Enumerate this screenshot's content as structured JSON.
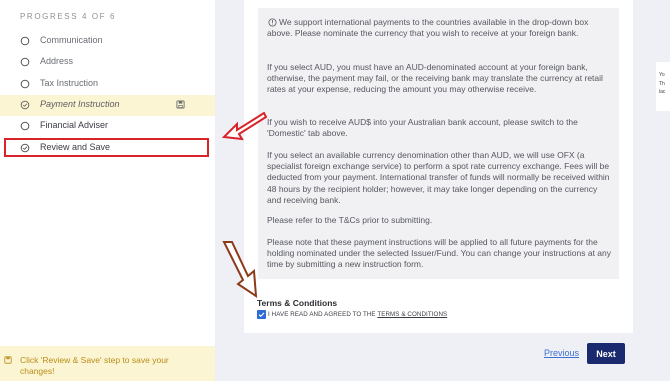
{
  "sidebar": {
    "progress": "PROGRESS 4 OF 6",
    "steps": [
      {
        "label": "Communication",
        "state": "done"
      },
      {
        "label": "Address",
        "state": "done"
      },
      {
        "label": "Tax Instruction",
        "state": "done"
      },
      {
        "label": "Payment Instruction",
        "state": "current"
      },
      {
        "label": "Financial Adviser",
        "state": "todo"
      },
      {
        "label": "Review and Save",
        "state": "highlighted"
      }
    ],
    "footer_message": "Click 'Review & Save' step to save your changes!"
  },
  "info": {
    "paragraphs": [
      "We support international payments to the countries available in the drop-down box above. Please nominate the currency that you wish to receive at your foreign bank.",
      "If you select AUD, you must have an AUD-denominated account at your foreign bank, otherwise, the payment may fail, or the receiving bank may translate the currency at retail rates at your expense, reducing the amount you may otherwise receive.",
      "If you wish to receive AUD$ into your Australian bank account, please switch to the 'Domestic' tab above.",
      "If you select an available currency denomination other than AUD, we will use OFX (a specialist foreign exchange service) to perform a spot rate currency exchange. Fees will be deducted from your payment. International transfer of funds will normally be received within 48 hours by the recipient holder; however, it may take longer depending on the currency and receiving bank.",
      "Please refer to the T&Cs prior to submitting.",
      "Please note that these payment instructions will be applied to all future payments for the holding nominated under the selected Issuer/Fund. You can change your instructions at any time by submitting a new instruction form."
    ]
  },
  "terms": {
    "title": "Terms & Conditions",
    "checkbox_prefix": "I HAVE READ AND AGREED TO THE",
    "checkbox_link": "TERMS & CONDITIONS",
    "checked": true
  },
  "nav": {
    "previous": "Previous",
    "next": "Next"
  },
  "right_panel": {
    "lines": [
      "Yo",
      "Th",
      "lac"
    ]
  },
  "colors": {
    "accent": "#1b2a6e",
    "link": "#3f6fd1",
    "highlight": "#fcf5d3",
    "annotation_red": "#d8232a",
    "annotation_brown": "#8b3a1a"
  }
}
